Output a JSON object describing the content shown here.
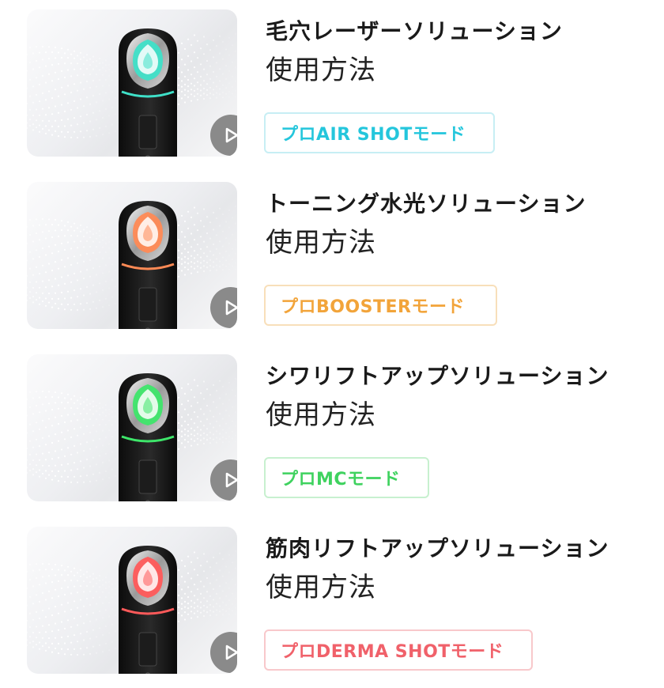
{
  "solutions": [
    {
      "title": "毛穴レーザーソリューション",
      "subtitle": "使用方法",
      "mode_label": "プロAIR SHOTモード",
      "mode_color": "#24c6dc",
      "mode_border": "#c7eef4",
      "light_color": "#3fe0c8"
    },
    {
      "title": "トーニング水光ソリューション",
      "subtitle": "使用方法",
      "mode_label": "プロBOOSTERモード",
      "mode_color": "#f2a43a",
      "mode_border": "#f8dfba",
      "light_color": "#ff8a55"
    },
    {
      "title": "シワリフトアップソリューション",
      "subtitle": "使用方法",
      "mode_label": "プロMCモード",
      "mode_color": "#3fd25f",
      "mode_border": "#c7f0cf",
      "light_color": "#3ee66a"
    },
    {
      "title": "筋肉リフトアップソリューション",
      "subtitle": "使用方法",
      "mode_label": "プロDERMA SHOTモード",
      "mode_color": "#f0616a",
      "mode_border": "#f8c8cb",
      "light_color": "#ff5a5a"
    }
  ],
  "icons": {
    "play": "play-icon"
  }
}
